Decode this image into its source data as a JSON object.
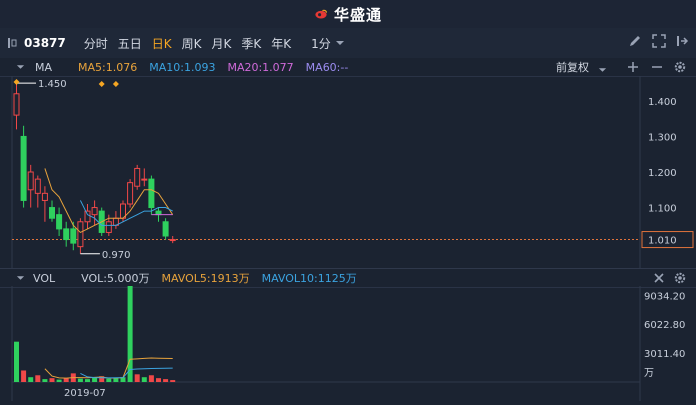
{
  "brand": {
    "name": "华盛通",
    "logo_color": "#e53935"
  },
  "toolbar": {
    "stock_code": "03877",
    "periods": [
      "分时",
      "五日",
      "日K",
      "周K",
      "月K",
      "季K",
      "年K"
    ],
    "active_period": "日K",
    "minute_selector": "1分",
    "icons": [
      "pause-bars-icon",
      "pencil-icon",
      "expand-icon",
      "exit-icon"
    ]
  },
  "main_header": {
    "indicator": "MA",
    "ma5": "MA5:1.076",
    "ma10": "MA10:1.093",
    "ma20": "MA20:1.077",
    "ma60": "MA60:--",
    "adjust": "前复权",
    "colors": {
      "ma5": "#e8a33c",
      "ma10": "#3ba3e0",
      "ma20": "#cf6ad9",
      "ma60": "#9b8cf0"
    }
  },
  "vol_header": {
    "indicator": "VOL",
    "vol": "VOL:5.000万",
    "mavol5": "MAVOL5:1913万",
    "mavol10": "MAVOL10:1125万"
  },
  "chart_data": [
    {
      "type": "candlestick",
      "title": "",
      "y_ticks": [
        "1.400",
        "1.300",
        "1.200",
        "1.100",
        "1.010"
      ],
      "ylim": [
        0.93,
        1.47
      ],
      "annotations": {
        "high_label": "1.450",
        "low_label": "0.970",
        "current_price": "1.010"
      },
      "candles": [
        {
          "o": 1.36,
          "h": 1.45,
          "l": 1.32,
          "c": 1.42
        },
        {
          "o": 1.3,
          "h": 1.33,
          "l": 1.1,
          "c": 1.12
        },
        {
          "o": 1.15,
          "h": 1.22,
          "l": 1.1,
          "c": 1.2
        },
        {
          "o": 1.14,
          "h": 1.19,
          "l": 1.1,
          "c": 1.18
        },
        {
          "o": 1.12,
          "h": 1.16,
          "l": 1.06,
          "c": 1.14
        },
        {
          "o": 1.1,
          "h": 1.12,
          "l": 1.06,
          "c": 1.07
        },
        {
          "o": 1.08,
          "h": 1.1,
          "l": 1.02,
          "c": 1.04
        },
        {
          "o": 1.04,
          "h": 1.06,
          "l": 0.99,
          "c": 1.01
        },
        {
          "o": 1.04,
          "h": 1.06,
          "l": 0.98,
          "c": 1.0
        },
        {
          "o": 0.99,
          "h": 1.07,
          "l": 0.97,
          "c": 1.06
        },
        {
          "o": 1.06,
          "h": 1.11,
          "l": 1.04,
          "c": 1.09
        },
        {
          "o": 1.08,
          "h": 1.12,
          "l": 1.05,
          "c": 1.1
        },
        {
          "o": 1.09,
          "h": 1.1,
          "l": 1.02,
          "c": 1.03
        },
        {
          "o": 1.03,
          "h": 1.08,
          "l": 1.02,
          "c": 1.06
        },
        {
          "o": 1.05,
          "h": 1.09,
          "l": 1.04,
          "c": 1.07
        },
        {
          "o": 1.07,
          "h": 1.12,
          "l": 1.06,
          "c": 1.11
        },
        {
          "o": 1.11,
          "h": 1.18,
          "l": 1.1,
          "c": 1.17
        },
        {
          "o": 1.16,
          "h": 1.22,
          "l": 1.15,
          "c": 1.21
        },
        {
          "o": 1.18,
          "h": 1.21,
          "l": 1.16,
          "c": 1.18
        },
        {
          "o": 1.18,
          "h": 1.19,
          "l": 1.08,
          "c": 1.1
        },
        {
          "o": 1.09,
          "h": 1.1,
          "l": 1.06,
          "c": 1.08
        },
        {
          "o": 1.06,
          "h": 1.07,
          "l": 1.01,
          "c": 1.02
        },
        {
          "o": 1.01,
          "h": 1.02,
          "l": 1.0,
          "c": 1.01
        }
      ],
      "ma5": [
        null,
        null,
        null,
        null,
        1.21,
        1.15,
        1.13,
        1.09,
        1.05,
        1.03,
        1.04,
        1.05,
        1.06,
        1.07,
        1.07,
        1.07,
        1.09,
        1.12,
        1.15,
        1.15,
        1.14,
        1.11,
        1.08
      ],
      "ma10": [
        null,
        null,
        null,
        null,
        null,
        null,
        null,
        null,
        null,
        1.12,
        1.08,
        1.07,
        1.05,
        1.05,
        1.05,
        1.06,
        1.07,
        1.08,
        1.09,
        1.09,
        1.1,
        1.1,
        1.09
      ],
      "ma20": [
        null,
        null,
        null,
        null,
        null,
        null,
        null,
        null,
        null,
        null,
        null,
        null,
        null,
        null,
        null,
        null,
        null,
        null,
        null,
        1.08,
        1.08,
        1.08,
        1.08
      ]
    },
    {
      "type": "bar",
      "title": "",
      "y_ticks": [
        "9034.20",
        "6022.80",
        "3011.40",
        "万"
      ],
      "ylim": [
        0,
        10000
      ],
      "x_ticks": [
        "2019-07"
      ],
      "volumes": [
        {
          "v": 4200,
          "up": true
        },
        {
          "v": 1200,
          "up": false
        },
        {
          "v": 500,
          "up": true
        },
        {
          "v": 700,
          "up": false
        },
        {
          "v": 300,
          "up": true
        },
        {
          "v": 400,
          "up": false
        },
        {
          "v": 250,
          "up": true
        },
        {
          "v": 400,
          "up": false
        },
        {
          "v": 900,
          "up": false
        },
        {
          "v": 350,
          "up": true
        },
        {
          "v": 300,
          "up": true
        },
        {
          "v": 450,
          "up": true
        },
        {
          "v": 600,
          "up": false
        },
        {
          "v": 350,
          "up": true
        },
        {
          "v": 400,
          "up": true
        },
        {
          "v": 500,
          "up": true
        },
        {
          "v": 10000,
          "up": true
        },
        {
          "v": 800,
          "up": false
        },
        {
          "v": 500,
          "up": true
        },
        {
          "v": 700,
          "up": false
        },
        {
          "v": 400,
          "up": false
        },
        {
          "v": 300,
          "up": false
        },
        {
          "v": 200,
          "up": false
        }
      ],
      "mavol5": [
        null,
        null,
        null,
        null,
        1380,
        620,
        430,
        410,
        450,
        460,
        440,
        480,
        520,
        410,
        420,
        460,
        2370,
        2410,
        2460,
        2500,
        2480,
        2460,
        2450
      ],
      "mavol10": [
        null,
        null,
        null,
        null,
        null,
        null,
        null,
        null,
        null,
        890,
        530,
        450,
        440,
        430,
        440,
        450,
        1300,
        1350,
        1380,
        1400,
        1420,
        1430,
        1440
      ]
    }
  ]
}
